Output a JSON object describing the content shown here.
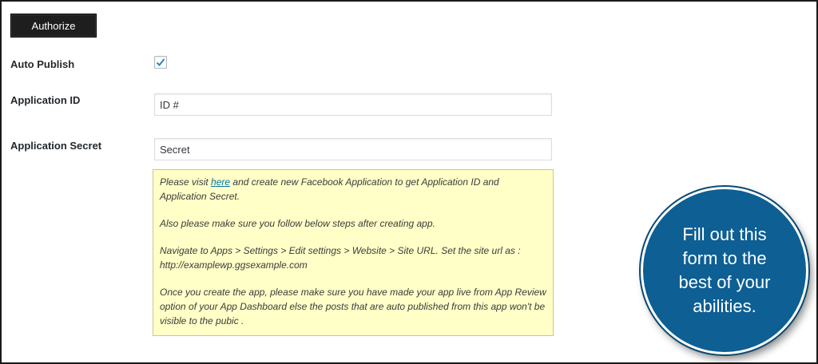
{
  "authorize_button": "Authorize",
  "fields": {
    "auto_publish": {
      "label": "Auto Publish",
      "checked": true
    },
    "app_id": {
      "label": "Application ID",
      "value": "ID #"
    },
    "app_secret": {
      "label": "Application Secret",
      "value": "Secret"
    }
  },
  "note": {
    "p1_pre": "Please visit ",
    "p1_link": "here",
    "p1_post": " and create new Facebook Application to get Application ID and Application Secret.",
    "p2": "Also please make sure you follow below steps after creating app.",
    "p3": "Navigate to Apps > Settings > Edit settings > Website > Site URL. Set the site url as : http://examplewp.ggsexample.com",
    "p4": "Once you create the app, please make sure you have made your app live from App Review option of your App Dashboard else the posts that are auto published from this app won't be visible to the pubic ."
  },
  "callout": {
    "text": "Fill out this form to the best of your abilities."
  },
  "colors": {
    "callout_bg": "#0d5f94",
    "note_bg": "#ffffc7",
    "button_bg": "#1e1e1e",
    "link": "#0073aa"
  }
}
